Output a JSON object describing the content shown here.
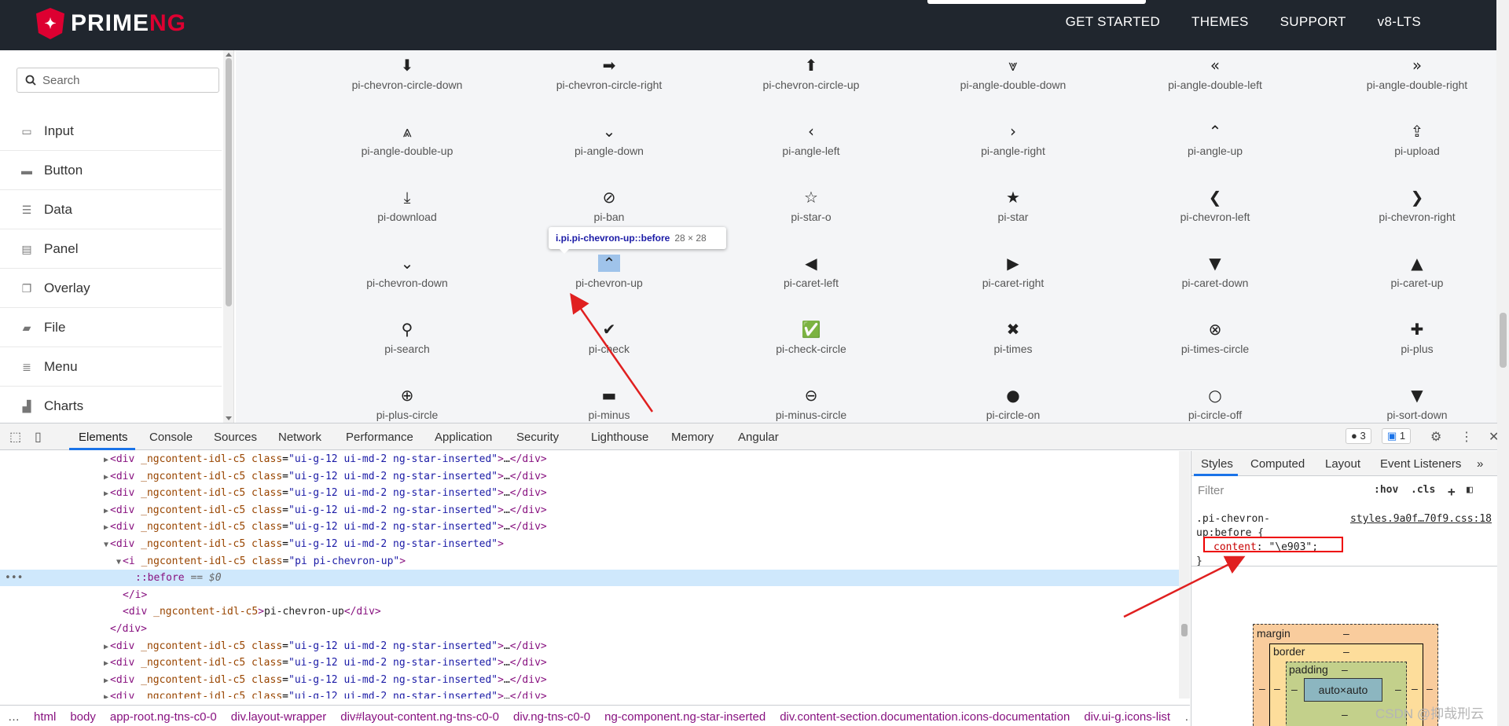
{
  "header": {
    "logo_text_prime": "PRIME",
    "logo_text_ng": "NG",
    "nav": [
      "GET STARTED",
      "THEMES",
      "SUPPORT",
      "v8-LTS"
    ]
  },
  "sidebar": {
    "search_placeholder": "Search",
    "items": [
      {
        "label": "Input",
        "icon": "input-icon"
      },
      {
        "label": "Button",
        "icon": "button-icon"
      },
      {
        "label": "Data",
        "icon": "database-icon"
      },
      {
        "label": "Panel",
        "icon": "panel-icon"
      },
      {
        "label": "Overlay",
        "icon": "overlay-icon"
      },
      {
        "label": "File",
        "icon": "file-icon"
      },
      {
        "label": "Menu",
        "icon": "menu-icon"
      },
      {
        "label": "Charts",
        "icon": "chart-icon"
      }
    ]
  },
  "icons": {
    "rows": [
      [
        {
          "glyph": "⬇",
          "name": "pi-chevron-circle-down"
        },
        {
          "glyph": "➡",
          "name": "pi-chevron-circle-right"
        },
        {
          "glyph": "⬆",
          "name": "pi-chevron-circle-up"
        },
        {
          "glyph": "⩔",
          "name": "pi-angle-double-down"
        },
        {
          "glyph": "«",
          "name": "pi-angle-double-left"
        },
        {
          "glyph": "»",
          "name": "pi-angle-double-right"
        }
      ],
      [
        {
          "glyph": "⩓",
          "name": "pi-angle-double-up"
        },
        {
          "glyph": "⌄",
          "name": "pi-angle-down"
        },
        {
          "glyph": "‹",
          "name": "pi-angle-left"
        },
        {
          "glyph": "›",
          "name": "pi-angle-right"
        },
        {
          "glyph": "⌃",
          "name": "pi-angle-up"
        },
        {
          "glyph": "⇪",
          "name": "pi-upload"
        }
      ],
      [
        {
          "glyph": "⤓",
          "name": "pi-download"
        },
        {
          "glyph": "⊘",
          "name": "pi-ban"
        },
        {
          "glyph": "☆",
          "name": "pi-star-o"
        },
        {
          "glyph": "★",
          "name": "pi-star"
        },
        {
          "glyph": "❮",
          "name": "pi-chevron-left"
        },
        {
          "glyph": "❯",
          "name": "pi-chevron-right"
        }
      ],
      [
        {
          "glyph": "⌄",
          "name": "pi-chevron-down"
        },
        {
          "glyph": "⌃",
          "name": "pi-chevron-up"
        },
        {
          "glyph": "◀",
          "name": "pi-caret-left"
        },
        {
          "glyph": "▶",
          "name": "pi-caret-right"
        },
        {
          "glyph": "▼",
          "name": "pi-caret-down"
        },
        {
          "glyph": "▲",
          "name": "pi-caret-up"
        }
      ],
      [
        {
          "glyph": "⚲",
          "name": "pi-search"
        },
        {
          "glyph": "✔",
          "name": "pi-check"
        },
        {
          "glyph": "✅",
          "name": "pi-check-circle"
        },
        {
          "glyph": "✖",
          "name": "pi-times"
        },
        {
          "glyph": "⊗",
          "name": "pi-times-circle"
        },
        {
          "glyph": "✚",
          "name": "pi-plus"
        }
      ],
      [
        {
          "glyph": "⊕",
          "name": "pi-plus-circle"
        },
        {
          "glyph": "▬",
          "name": "pi-minus"
        },
        {
          "glyph": "⊖",
          "name": "pi-minus-circle"
        },
        {
          "glyph": "●",
          "name": "pi-circle-on"
        },
        {
          "glyph": "○",
          "name": "pi-circle-off"
        },
        {
          "glyph": "▼",
          "name": "pi-sort-down"
        }
      ]
    ],
    "tooltip_selector": "i.pi.pi-chevron-up::before",
    "tooltip_size": "28 × 28"
  },
  "devtools": {
    "tabs": [
      "Elements",
      "Console",
      "Sources",
      "Network",
      "Performance",
      "Application",
      "Security",
      "Lighthouse",
      "Memory",
      "Angular"
    ],
    "error_count": "3",
    "message_count": "1",
    "elements_lines": [
      {
        "indent": 1,
        "tri": "▶",
        "html": "collapsed"
      },
      {
        "indent": 1,
        "tri": "▶",
        "html": "collapsed"
      },
      {
        "indent": 1,
        "tri": "▶",
        "html": "collapsed"
      },
      {
        "indent": 1,
        "tri": "▶",
        "html": "collapsed"
      },
      {
        "indent": 1,
        "tri": "▶",
        "html": "collapsed"
      },
      {
        "indent": 1,
        "tri": "▼",
        "html": "open"
      },
      {
        "indent": 2,
        "tri": "▼",
        "html": "i-open"
      },
      {
        "indent": 3,
        "tri": "",
        "html": "before"
      },
      {
        "indent": 2,
        "tri": "",
        "html": "i-close"
      },
      {
        "indent": 2,
        "tri": "",
        "html": "div-text"
      },
      {
        "indent": 1,
        "tri": "",
        "html": "div-close"
      },
      {
        "indent": 1,
        "tri": "▶",
        "html": "collapsed"
      },
      {
        "indent": 1,
        "tri": "▶",
        "html": "collapsed"
      },
      {
        "indent": 1,
        "tri": "▶",
        "html": "collapsed"
      },
      {
        "indent": 1,
        "tri": "▶",
        "html": "collapsed"
      }
    ],
    "div_tag": "div",
    "div_attrs": "_ngcontent-idl-c5",
    "div_class_attr": "class",
    "div_class": "ui-g-12 ui-md-2 ng-star-inserted",
    "i_tag": "i",
    "i_class": "pi pi-chevron-up",
    "before_text": "::before",
    "before_eq": "== $0",
    "div_text": "pi-chevron-up",
    "crumbs": [
      "…",
      "html",
      "body",
      "app-root.ng-tns-c0-0",
      "div.layout-wrapper",
      "div#layout-content.ng-tns-c0-0",
      "div.ng-tns-c0-0",
      "ng-component.ng-star-inserted",
      "div.content-section.documentation.icons-documentation",
      "div.ui-g.icons-list",
      "…"
    ],
    "styles_tabs": [
      "Styles",
      "Computed",
      "Layout",
      "Event Listeners",
      "»"
    ],
    "filter_placeholder": "Filter",
    "hov": ":hov",
    "cls": ".cls",
    "rule_selector_1": ".pi-chevron-",
    "rule_selector_2": "up:before {",
    "rule_source": "styles.9a0f…70f9.css:18",
    "rule_prop": "content",
    "rule_value": "\"\\e903\";",
    "rule_close": "}",
    "box_margin": "margin",
    "box_border": "border",
    "box_padding": "padding",
    "box_content": "auto×auto",
    "dash": "–"
  },
  "watermark": "CSDN @抑哉刑云"
}
